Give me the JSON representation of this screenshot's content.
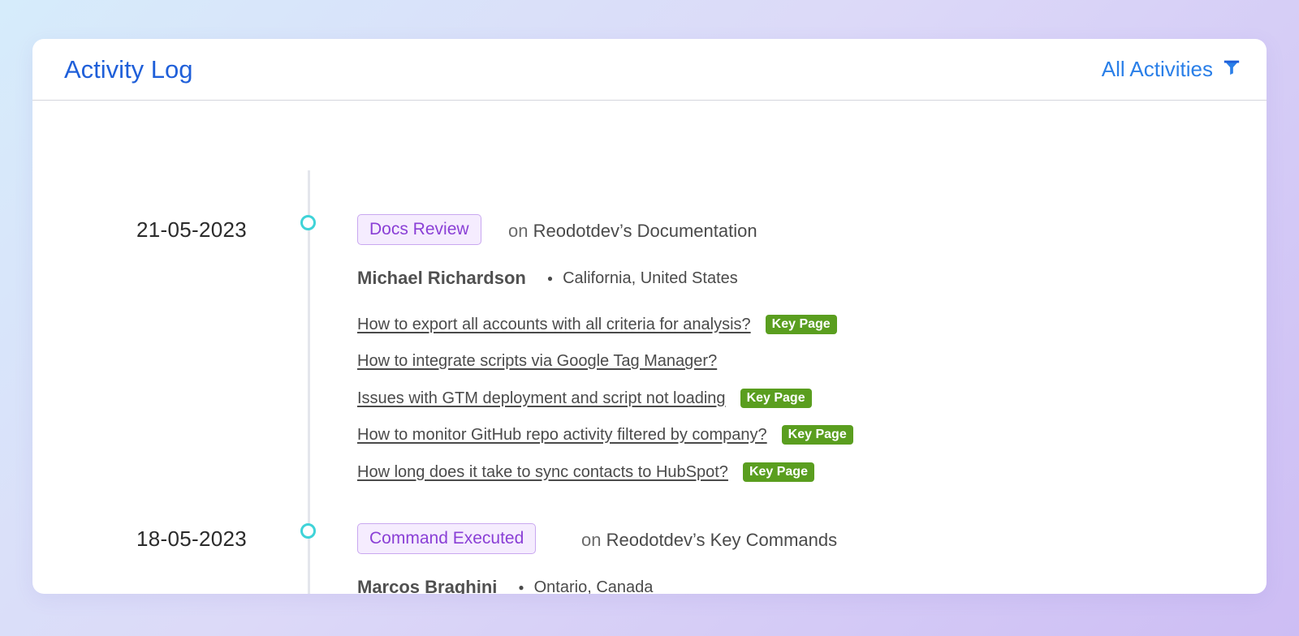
{
  "header": {
    "title": "Activity Log",
    "filter_label": "All Activities",
    "filter_icon": "funnel-icon"
  },
  "entries": [
    {
      "date": "21-05-2023",
      "tag": "Docs Review",
      "on": "on",
      "target": "Reodotdev’s Documentation",
      "name": "Michael Richardson",
      "location": "California, United States",
      "links": [
        {
          "text": "How to export all accounts with all criteria for analysis?",
          "badge": "Key Page"
        },
        {
          "text": "How to integrate scripts via Google Tag Manager?",
          "badge": ""
        },
        {
          "text": "Issues with GTM deployment and script not loading",
          "badge": "Key Page"
        },
        {
          "text": "How to monitor GitHub repo activity filtered by company?",
          "badge": "Key Page"
        },
        {
          "text": "How long does it take to sync contacts to HubSpot?",
          "badge": "Key Page"
        }
      ]
    },
    {
      "date": "18-05-2023",
      "tag": "Command Executed",
      "on": "on",
      "target": "Reodotdev’s Key Commands",
      "name": "Marcos Braghini",
      "location": "Ontario, Canada",
      "links": []
    }
  ],
  "colors": {
    "accent": "#1f5fd9",
    "timeline_dot": "#3fd3d8",
    "tag_text": "#8a3fd6",
    "tag_bg": "#f5ecfe",
    "key_badge": "#5a9e1f"
  }
}
